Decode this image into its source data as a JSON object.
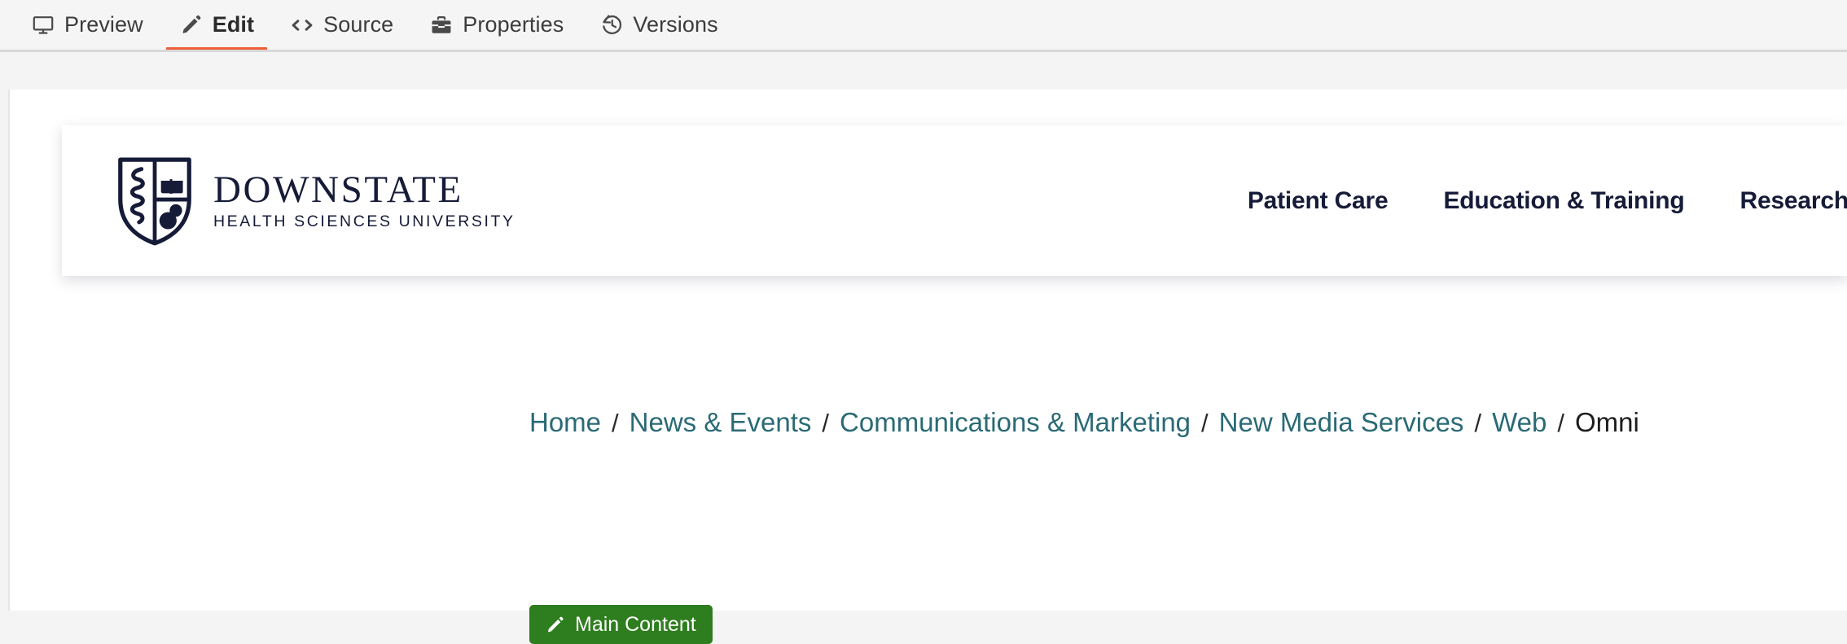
{
  "editor_tabs": {
    "items": [
      {
        "label": "Preview",
        "icon": "monitor-icon",
        "active": false
      },
      {
        "label": "Edit",
        "icon": "pencil-icon",
        "active": true
      },
      {
        "label": "Source",
        "icon": "code-icon",
        "active": false
      },
      {
        "label": "Properties",
        "icon": "toolbox-icon",
        "active": false
      },
      {
        "label": "Versions",
        "icon": "history-icon",
        "active": false
      }
    ],
    "active_indicator_color": "#ec5f3a"
  },
  "site_header": {
    "logo": {
      "icon": "downstate-shield-icon",
      "name": "DOWNSTATE",
      "tagline": "HEALTH SCIENCES UNIVERSITY",
      "color": "#161b38"
    },
    "nav_items": [
      {
        "label": "Patient Care"
      },
      {
        "label": "Education & Training"
      },
      {
        "label": "Research"
      }
    ]
  },
  "breadcrumb": {
    "separator": "/",
    "items": [
      {
        "label": "Home",
        "current": false
      },
      {
        "label": "News & Events",
        "current": false
      },
      {
        "label": "Communications & Marketing",
        "current": false
      },
      {
        "label": "New Media Services",
        "current": false
      },
      {
        "label": "Web",
        "current": false
      },
      {
        "label": "Omni",
        "current": true
      }
    ],
    "link_color": "#2a6a75"
  },
  "main_content_button": {
    "label": "Main Content",
    "icon": "pencil-icon",
    "background_color": "#2e7d1e",
    "text_color": "#ffffff"
  }
}
